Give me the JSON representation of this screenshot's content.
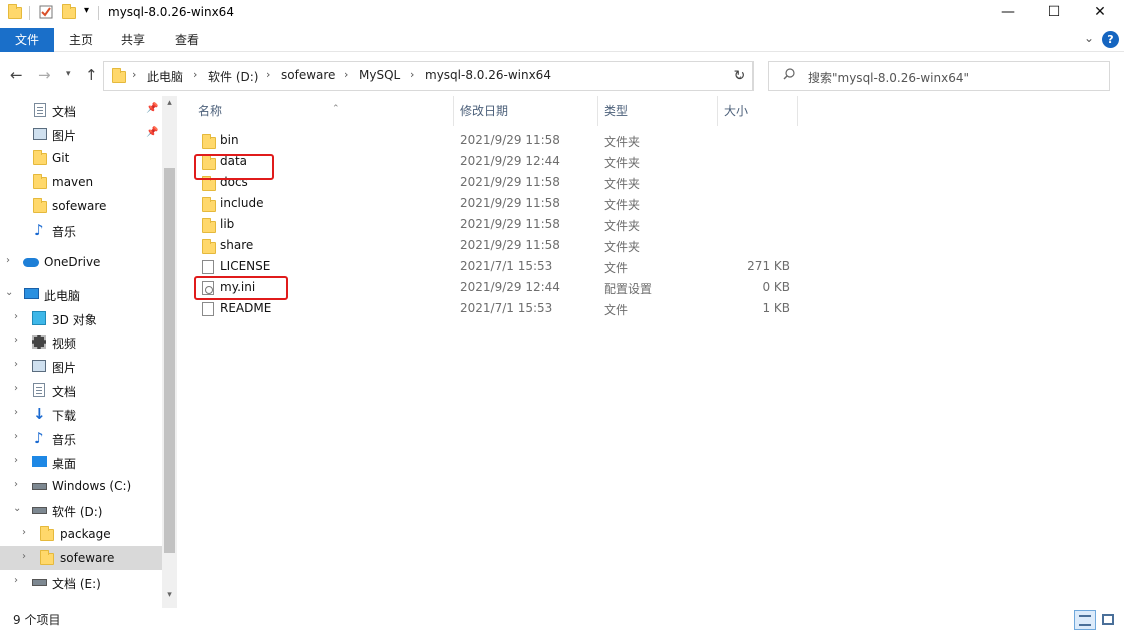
{
  "window": {
    "title": "mysql-8.0.26-winx64",
    "minimize": "—",
    "maximize": "☐",
    "close": "✕"
  },
  "ribbon": {
    "tabs": [
      "文件",
      "主页",
      "共享",
      "查看"
    ],
    "help": "?"
  },
  "address": {
    "crumbs": [
      "此电脑",
      "软件 (D:)",
      "sofeware",
      "MySQL",
      "mysql-8.0.26-winx64"
    ]
  },
  "search": {
    "placeholder": "搜索\"mysql-8.0.26-winx64\""
  },
  "sidebar": {
    "items": [
      {
        "label": "文档",
        "icon": "document-icon",
        "pinned": true
      },
      {
        "label": "图片",
        "icon": "picture-icon",
        "pinned": true
      },
      {
        "label": "Git",
        "icon": "folder-icon"
      },
      {
        "label": "maven",
        "icon": "folder-icon"
      },
      {
        "label": "sofeware",
        "icon": "folder-icon"
      },
      {
        "label": "音乐",
        "icon": "music-icon"
      },
      {
        "label": "OneDrive",
        "icon": "onedrive-icon"
      },
      {
        "label": "此电脑",
        "icon": "this-pc-icon"
      },
      {
        "label": "3D 对象",
        "icon": "3d-objects-icon"
      },
      {
        "label": "视频",
        "icon": "video-icon"
      },
      {
        "label": "图片",
        "icon": "picture-icon"
      },
      {
        "label": "文档",
        "icon": "document-icon"
      },
      {
        "label": "下载",
        "icon": "download-icon"
      },
      {
        "label": "音乐",
        "icon": "music-icon"
      },
      {
        "label": "桌面",
        "icon": "desktop-icon"
      },
      {
        "label": "Windows (C:)",
        "icon": "drive-icon"
      },
      {
        "label": "软件 (D:)",
        "icon": "drive-icon"
      },
      {
        "label": "package",
        "icon": "folder-icon"
      },
      {
        "label": "sofeware",
        "icon": "folder-icon",
        "selected": true
      },
      {
        "label": "文档 (E:)",
        "icon": "drive-icon"
      }
    ]
  },
  "columns": {
    "name": "名称",
    "date": "修改日期",
    "type": "类型",
    "size": "大小"
  },
  "files": [
    {
      "name": "bin",
      "date": "2021/9/29 11:58",
      "type": "文件夹",
      "size": "",
      "icon": "folder-icon"
    },
    {
      "name": "data",
      "date": "2021/9/29 12:44",
      "type": "文件夹",
      "size": "",
      "icon": "folder-icon",
      "highlighted": true
    },
    {
      "name": "docs",
      "date": "2021/9/29 11:58",
      "type": "文件夹",
      "size": "",
      "icon": "folder-icon"
    },
    {
      "name": "include",
      "date": "2021/9/29 11:58",
      "type": "文件夹",
      "size": "",
      "icon": "folder-icon"
    },
    {
      "name": "lib",
      "date": "2021/9/29 11:58",
      "type": "文件夹",
      "size": "",
      "icon": "folder-icon"
    },
    {
      "name": "share",
      "date": "2021/9/29 11:58",
      "type": "文件夹",
      "size": "",
      "icon": "folder-icon"
    },
    {
      "name": "LICENSE",
      "date": "2021/7/1 15:53",
      "type": "文件",
      "size": "271 KB",
      "icon": "file-icon"
    },
    {
      "name": "my.ini",
      "date": "2021/9/29 12:44",
      "type": "配置设置",
      "size": "0 KB",
      "icon": "ini-file-icon",
      "highlighted": true
    },
    {
      "name": "README",
      "date": "2021/7/1 15:53",
      "type": "文件",
      "size": "1 KB",
      "icon": "file-icon"
    }
  ],
  "status": {
    "count": "9 个项目"
  },
  "colors": {
    "file_tab": "#1a6fc9",
    "highlight": "#e01b1b",
    "folder": "#ffd86b"
  }
}
